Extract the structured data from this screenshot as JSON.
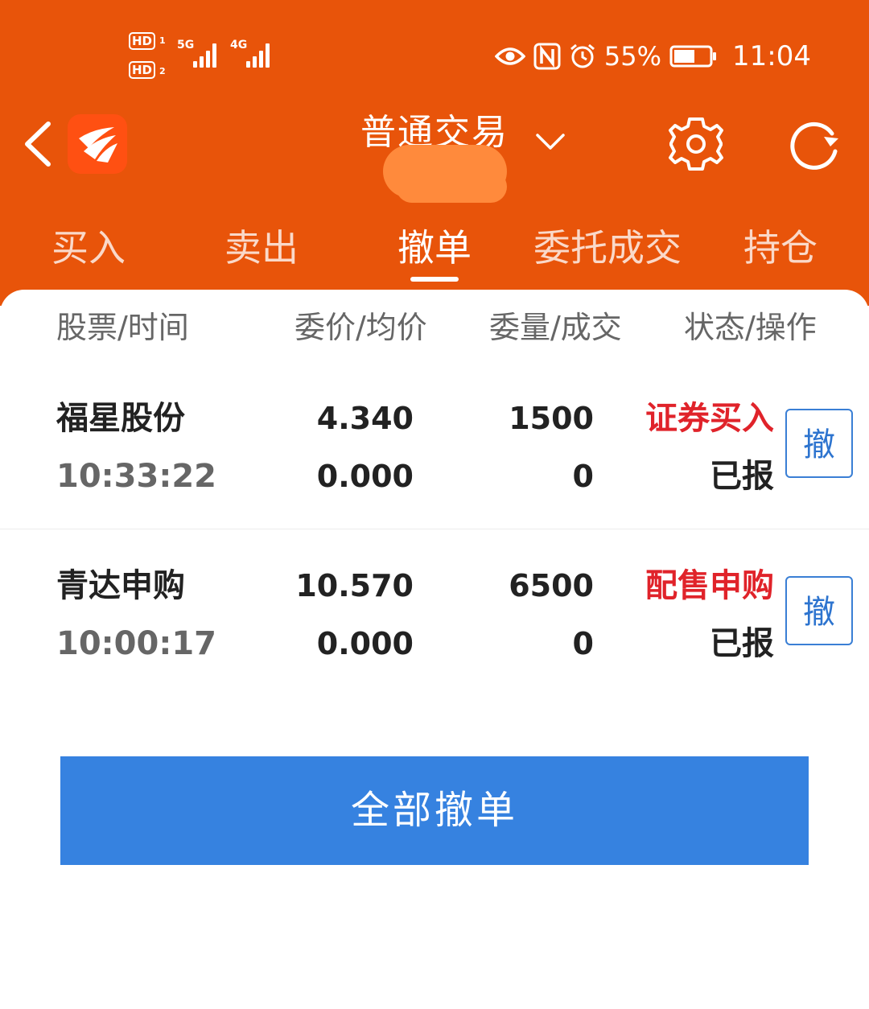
{
  "status_bar": {
    "hd1": "HD",
    "sim1": "1",
    "hd2": "HD",
    "sim2": "2",
    "net1": "5G",
    "net2": "4G",
    "battery": "55%",
    "time": "11:04"
  },
  "header": {
    "title": "普通交易"
  },
  "tabs": [
    {
      "label": "买入"
    },
    {
      "label": "卖出"
    },
    {
      "label": "撤单"
    },
    {
      "label": "委托成交"
    },
    {
      "label": "持仓"
    }
  ],
  "active_tab": "撤单",
  "columns": {
    "c1": "股票/时间",
    "c2": "委价/均价",
    "c3": "委量/成交",
    "c4": "状态/操作"
  },
  "orders": [
    {
      "name": "福星股份",
      "time": "10:33:22",
      "price": "4.340",
      "avg_price": "0.000",
      "qty": "1500",
      "filled": "0",
      "side": "证券买入",
      "status": "已报",
      "cancel_label": "撤"
    },
    {
      "name": "青达申购",
      "time": "10:00:17",
      "price": "10.570",
      "avg_price": "0.000",
      "qty": "6500",
      "filled": "0",
      "side": "配售申购",
      "status": "已报",
      "cancel_label": "撤"
    }
  ],
  "cancel_all_label": "全部撤单",
  "colors": {
    "header_orange": "#e8540a",
    "side_red": "#e0232a",
    "button_blue": "#3682e0"
  }
}
